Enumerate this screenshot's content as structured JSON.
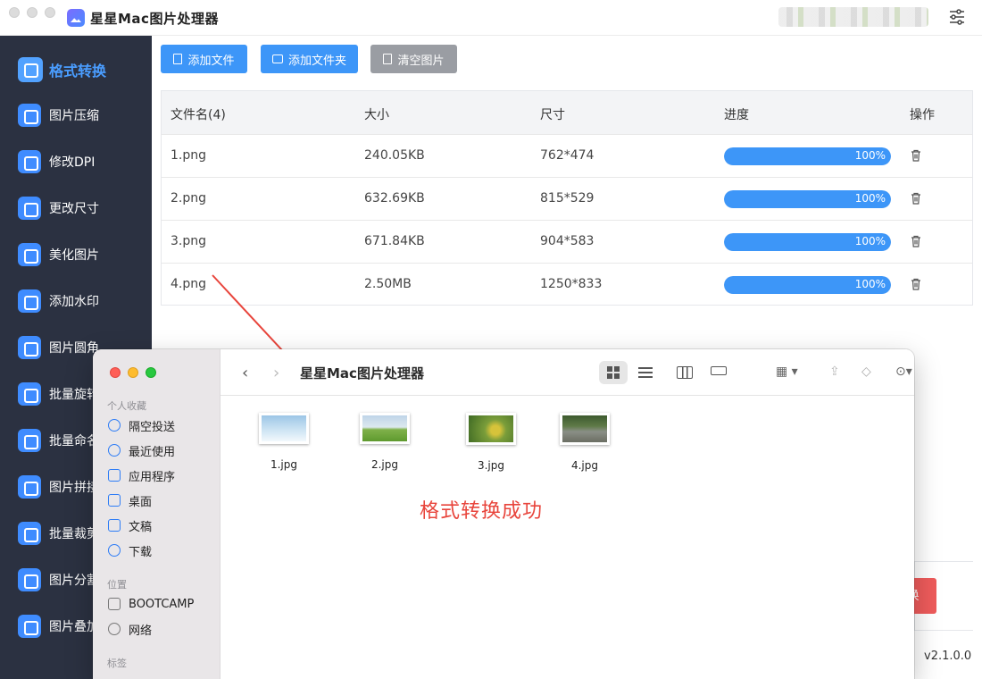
{
  "app": {
    "title": "星星Mac图片处理器",
    "version": "v2.1.0.0"
  },
  "sidebar": {
    "items": [
      {
        "label": "格式转换",
        "icon": "image-format-icon",
        "active": true
      },
      {
        "label": "图片压缩",
        "icon": "compress-icon"
      },
      {
        "label": "修改DPI",
        "icon": "dpi-icon"
      },
      {
        "label": "更改尺寸",
        "icon": "resize-icon"
      },
      {
        "label": "美化图片",
        "icon": "beautify-icon"
      },
      {
        "label": "添加水印",
        "icon": "watermark-icon"
      },
      {
        "label": "图片圆角",
        "icon": "round-corner-icon"
      },
      {
        "label": "批量旋转",
        "icon": "rotate-icon"
      },
      {
        "label": "批量命名",
        "icon": "rename-icon"
      },
      {
        "label": "图片拼接",
        "icon": "stitch-icon"
      },
      {
        "label": "批量裁剪",
        "icon": "crop-icon"
      },
      {
        "label": "图片分割",
        "icon": "split-icon"
      },
      {
        "label": "图片叠加",
        "icon": "overlay-icon"
      }
    ]
  },
  "toolbar": {
    "add_file": "添加文件",
    "add_folder": "添加文件夹",
    "clear": "清空图片"
  },
  "table": {
    "headers": [
      "文件名(4)",
      "大小",
      "尺寸",
      "进度",
      "操作"
    ],
    "rows": [
      {
        "name": "1.png",
        "size": "240.05KB",
        "dims": "762*474",
        "progress": 100,
        "progress_label": "100%"
      },
      {
        "name": "2.png",
        "size": "632.69KB",
        "dims": "815*529",
        "progress": 100,
        "progress_label": "100%"
      },
      {
        "name": "3.png",
        "size": "671.84KB",
        "dims": "904*583",
        "progress": 100,
        "progress_label": "100%"
      },
      {
        "name": "4.png",
        "size": "2.50MB",
        "dims": "1250*833",
        "progress": 100,
        "progress_label": "100%"
      }
    ]
  },
  "bottom": {
    "start_button_partial": "换"
  },
  "finder": {
    "title": "星星Mac图片处理器",
    "sections": {
      "favorites": "个人收藏",
      "locations": "位置",
      "tags": "标签"
    },
    "favorites": [
      "隔空投送",
      "最近使用",
      "应用程序",
      "桌面",
      "文稿",
      "下载"
    ],
    "locations": [
      "BOOTCAMP",
      "网络"
    ],
    "files": [
      {
        "name": "1.jpg"
      },
      {
        "name": "2.jpg"
      },
      {
        "name": "3.jpg"
      },
      {
        "name": "4.jpg"
      }
    ]
  },
  "annotation": {
    "text": "格式转换成功",
    "color": "#e8453c"
  }
}
